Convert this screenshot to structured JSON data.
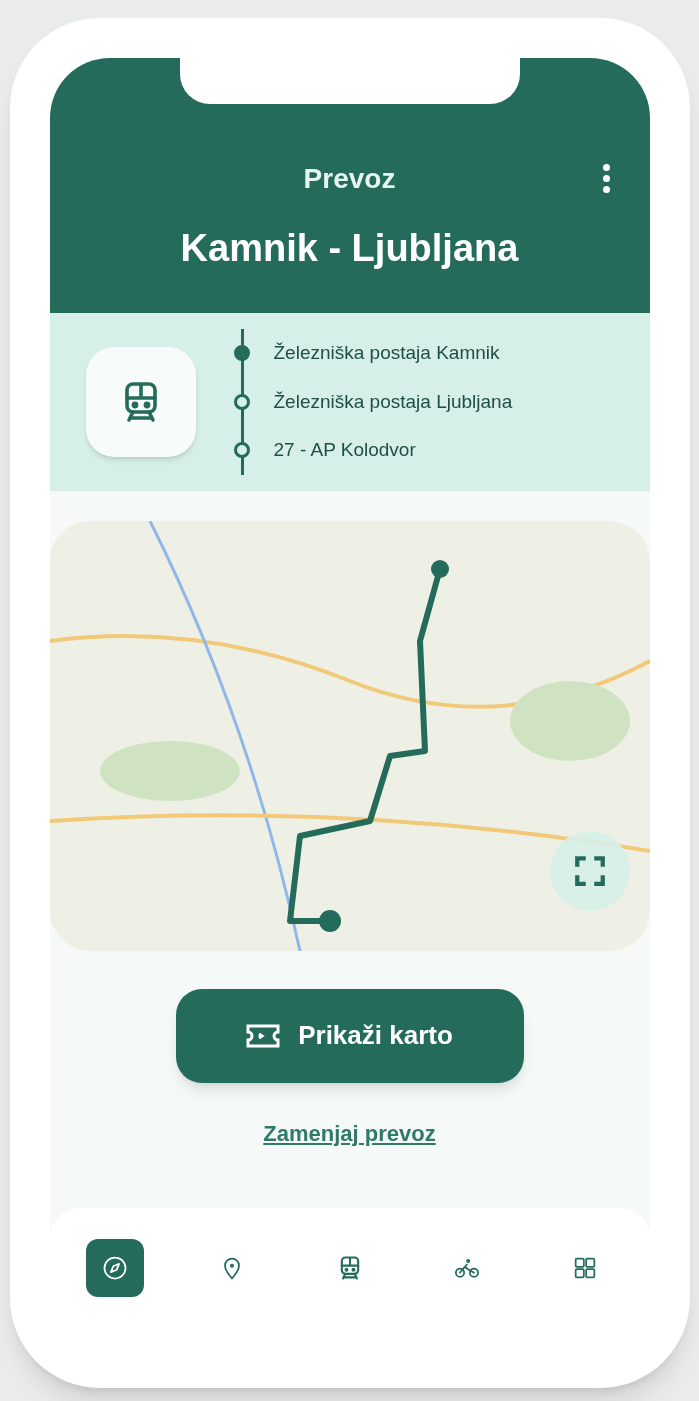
{
  "header": {
    "title": "Prevoz",
    "route": "Kamnik - Ljubljana"
  },
  "stops": [
    {
      "name": "Železniška postaja Kamnik",
      "reached": true
    },
    {
      "name": "Železniška postaja Ljubljana",
      "reached": false
    },
    {
      "name": "27 - AP Kolodvor",
      "reached": false
    }
  ],
  "primary_button": {
    "label": "Prikaži karto"
  },
  "link": {
    "label": "Zamenjaj prevoz"
  },
  "nav": [
    {
      "kind": "explore",
      "selected": true
    },
    {
      "kind": "places",
      "selected": false
    },
    {
      "kind": "train",
      "selected": false
    },
    {
      "kind": "bike",
      "selected": false
    },
    {
      "kind": "menu",
      "selected": false
    }
  ]
}
